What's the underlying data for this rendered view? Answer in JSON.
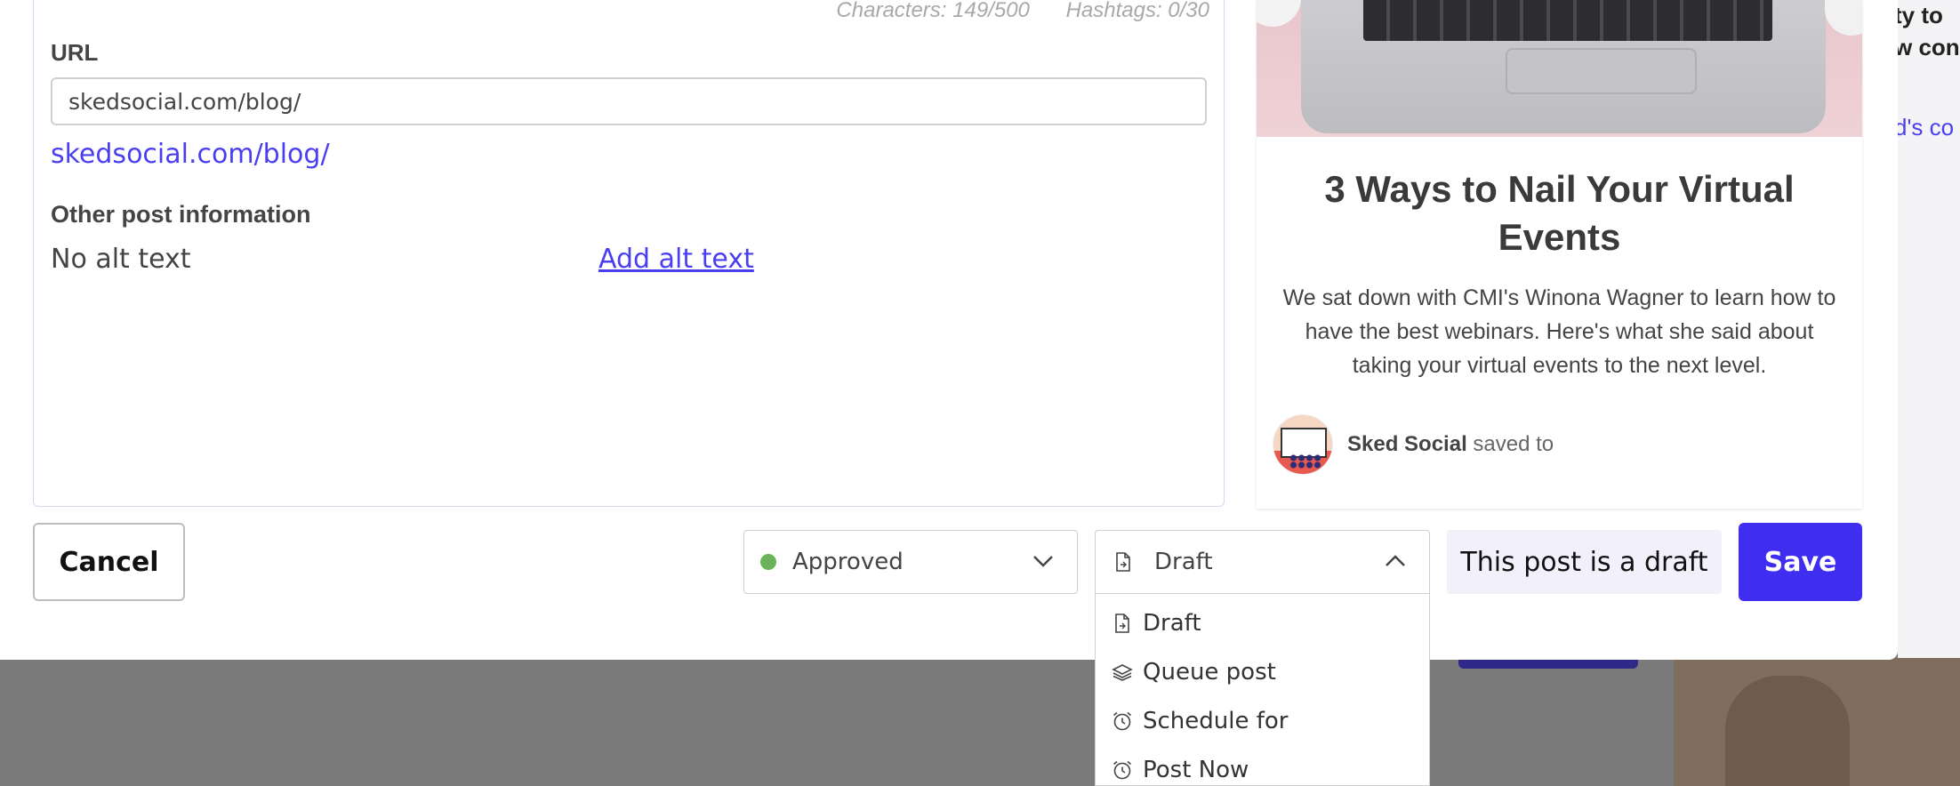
{
  "form": {
    "characters": "Characters: 149/500",
    "hashtags": "Hashtags: 0/30",
    "url_label": "URL",
    "url_value": "skedsocial.com/blog/",
    "url_link": "skedsocial.com/blog/",
    "other_label": "Other post information",
    "alt_value": "No alt text",
    "alt_link": "Add alt text"
  },
  "preview": {
    "title": "3 Ways to Nail Your Virtual Events",
    "description": "We sat down with CMI's Winona Wagner to learn how to have the best webinars. Here's what she said about taking your virtual events to the next level.",
    "author_name": "Sked Social",
    "author_suffix": " saved to"
  },
  "footer": {
    "cancel_label": "Cancel",
    "status_label": "Approved",
    "status_color": "#6bb35a",
    "type_label": "Draft",
    "draft_note": "This post is a draft",
    "save_label": "Save"
  },
  "dropdown": {
    "items": [
      {
        "label": "Draft",
        "icon": "file-icon"
      },
      {
        "label": "Queue post",
        "icon": "layers-icon"
      },
      {
        "label": "Schedule for",
        "icon": "alarm-clock-icon"
      },
      {
        "label": "Post Now",
        "icon": "alarm-clock-icon"
      }
    ]
  },
  "background": {
    "text_line_1": "ty to",
    "text_line_2": "w con",
    "link_text": "d's co"
  },
  "colors": {
    "accent": "#3f2ef0",
    "link": "#4a3ff0"
  }
}
